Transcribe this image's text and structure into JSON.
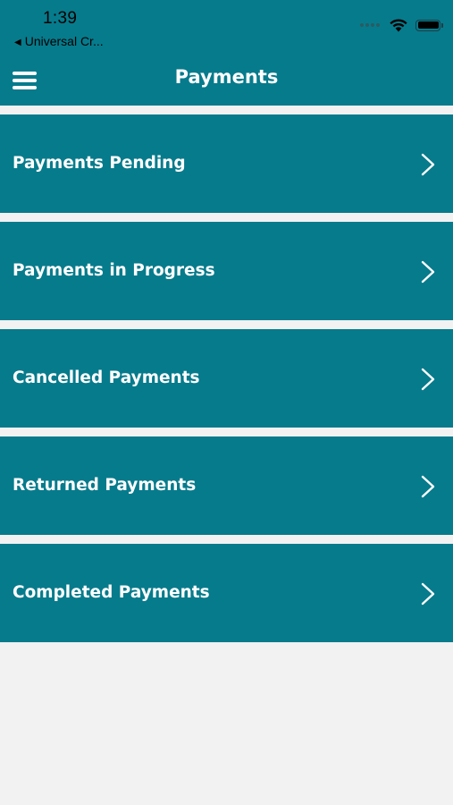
{
  "status_bar": {
    "time": "1:39",
    "back_app": "Universal Cr..."
  },
  "header": {
    "title": "Payments",
    "menu_icon": "hamburger-menu-icon"
  },
  "menu": {
    "items": [
      {
        "label": "Payments Pending",
        "icon": "chevron-right-icon"
      },
      {
        "label": "Payments in Progress",
        "icon": "chevron-right-icon"
      },
      {
        "label": "Cancelled Payments",
        "icon": "chevron-right-icon"
      },
      {
        "label": "Returned Payments",
        "icon": "chevron-right-icon"
      },
      {
        "label": "Completed Payments",
        "icon": "chevron-right-icon"
      }
    ]
  },
  "colors": {
    "primary": "#067b8c",
    "background": "#f2f2f2",
    "text_on_primary": "#ffffff"
  }
}
